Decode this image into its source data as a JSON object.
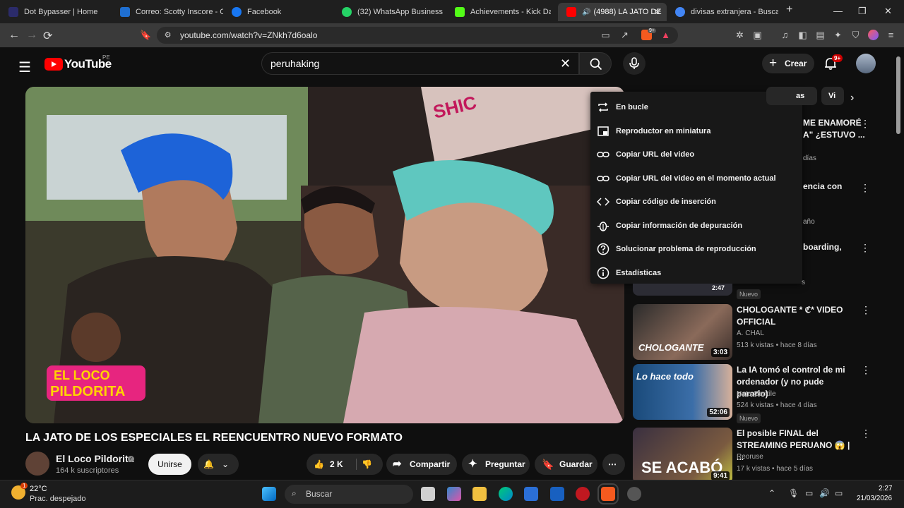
{
  "browser": {
    "tabs": [
      {
        "title": "Dot Bypasser | Home",
        "color": "#2b2b6a"
      },
      {
        "title": "Correo: Scotty Inscore - O",
        "color": "#1f6fd1"
      },
      {
        "title": "Facebook",
        "color": "#1877f2"
      },
      {
        "title": "(32) WhatsApp Business",
        "color": "#25d366"
      },
      {
        "title": "Achievements - Kick Dash",
        "color": "#53fc18"
      },
      {
        "title": "(4988) LA JATO DE",
        "color": "#ff0000"
      },
      {
        "title": "divisas extranjera - Buscar",
        "color": "#4285f4"
      }
    ],
    "url": "youtube.com/watch?v=ZNkh7d6oalo",
    "extension_badge": "9+"
  },
  "youtube": {
    "logo_text": "YouTube",
    "country": "PE",
    "search_value": "peruhaking",
    "create_label": "Crear",
    "notifications": "9+"
  },
  "video": {
    "title": "LA JATO DE LOS ESPECIALES EL REENCUENTRO NUEVO FORMATO",
    "channel": "El Loco Pildorita",
    "subscribers": "164 k suscriptores",
    "join_label": "Unirse",
    "likes": "2 K",
    "share_label": "Compartir",
    "ask_label": "Preguntar",
    "save_label": "Guardar",
    "sign_text": "SHIC",
    "logo_line1": "EL LOCO",
    "logo_line2": "PILDORITA"
  },
  "context_menu": [
    {
      "label": "En bucle",
      "icon": "loop-icon"
    },
    {
      "label": "Reproductor en miniatura",
      "icon": "miniplayer-icon"
    },
    {
      "label": "Copiar URL del video",
      "icon": "link-icon"
    },
    {
      "label": "Copiar URL del video en el momento actual",
      "icon": "link-icon"
    },
    {
      "label": "Copiar código de inserción",
      "icon": "code-icon"
    },
    {
      "label": "Copiar información de depuración",
      "icon": "bug-icon"
    },
    {
      "label": "Solucionar problema de reproducción",
      "icon": "help-icon"
    },
    {
      "label": "Estadísticas",
      "icon": "info-icon"
    }
  ],
  "chips": [
    "as",
    "Vi"
  ],
  "partial_recs": [
    {
      "title_a": "ME ENAMORÉ",
      "title_b": "A\" ¿ESTUVO ...",
      "meta": "días"
    },
    {
      "title_a": "encia con",
      "meta": "año"
    },
    {
      "title_a": "boarding,",
      "meta": "s"
    }
  ],
  "recommendations": [
    {
      "title": "CHOLOGANTE * ℭ* VIDEO OFFICIAL",
      "channel": "A. CHAL",
      "meta": "513 k vistas • hace 8 días",
      "duration": "3:03",
      "thumb_text": "CHOLOGANTE",
      "badge": ""
    },
    {
      "title": "La IA tomó el control de mi ordenador (y no pude pararlo)",
      "channel": "Nate Gentile",
      "meta": "524 k vistas • hace 4 días",
      "duration": "52:06",
      "thumb_text": "Lo hace todo",
      "badge": "Nuevo"
    },
    {
      "title": "El posible FINAL del STREAMING PERUANO 😱 | ...",
      "channel": "Reoruse",
      "meta": "17 k vistas • hace 5 días",
      "duration": "9:41",
      "thumb_text": "SE ACABÓ",
      "badge": ""
    }
  ],
  "partial_badge": "Nuevo",
  "partial_duration": "2:47",
  "taskbar": {
    "temperature": "22°C",
    "weather": "Prac. despejado",
    "weather_badge": "1",
    "search": "Buscar",
    "time": "2:27",
    "date": "21/03/2026"
  }
}
